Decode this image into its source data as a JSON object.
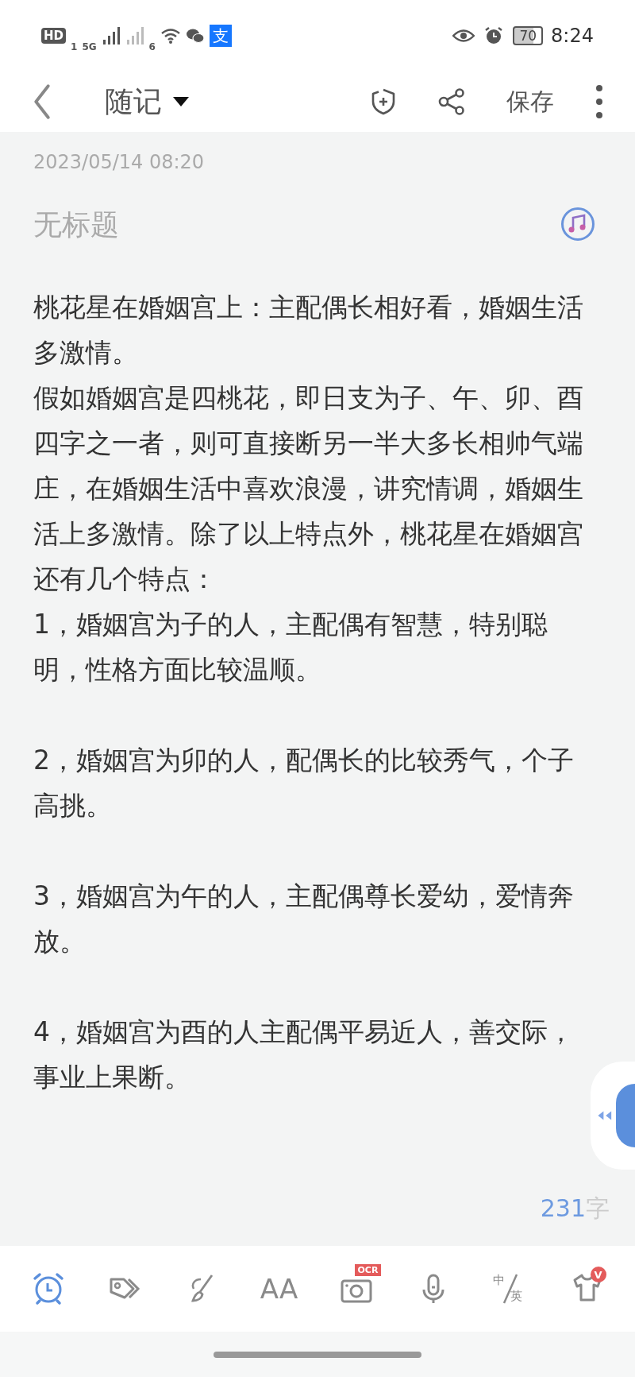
{
  "status_bar": {
    "hd": "HD",
    "sim": "1",
    "network": "5G",
    "wifi_label": "6",
    "alipay": "支",
    "battery": "70",
    "time": "8:24"
  },
  "header": {
    "title": "随记",
    "save": "保存"
  },
  "note": {
    "date": "2023/05/14 08:20",
    "title_placeholder": "无标题",
    "sections": [
      {
        "paragraphs": [
          "桃花星在婚姻宫上：主配偶长相好看，婚姻生活多激情。",
          "假如婚姻宫是四桃花，即日支为子、午、卯、酉四字之一者，则可直接断另一半大多长相帅气端庄，在婚姻生活中喜欢浪漫，讲究情调，婚姻生活上多激情。除了以上特点外，桃花星在婚姻宫还有几个特点：",
          "1，婚姻宫为子的人，主配偶有智慧，特别聪明，性格方面比较温顺。"
        ]
      },
      {
        "paragraphs": [
          "2，婚姻宫为卯的人，配偶长的比较秀气，个子高挑。"
        ]
      },
      {
        "paragraphs": [
          "3，婚姻宫为午的人，主配偶尊长爱幼，爱情奔放。"
        ]
      },
      {
        "paragraphs": [
          "4，婚姻宫为酉的人主配偶平易近人，善交际，事业上果断。"
        ]
      }
    ],
    "word_count": "231",
    "word_unit": "字"
  },
  "toolbar": [
    {
      "kind": "alarm",
      "selected": true
    },
    {
      "kind": "tag",
      "selected": false
    },
    {
      "kind": "brush",
      "selected": false
    },
    {
      "kind": "font",
      "selected": false,
      "glyph": "AA"
    },
    {
      "kind": "camera",
      "selected": false,
      "badge": "OCR"
    },
    {
      "kind": "mic",
      "selected": false
    },
    {
      "kind": "translate",
      "selected": false,
      "top": "中",
      "bottom": "英"
    },
    {
      "kind": "shirt",
      "selected": false,
      "badge": "V"
    }
  ]
}
